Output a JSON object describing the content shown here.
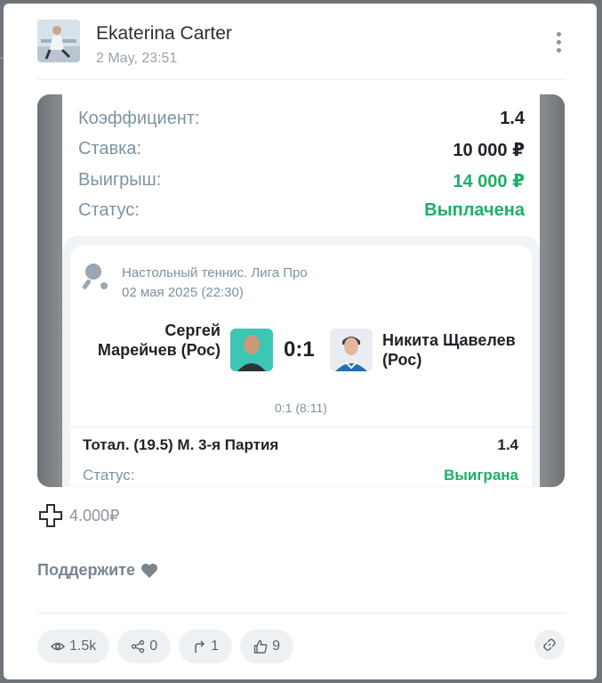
{
  "post": {
    "author": "Ekaterina Carter",
    "timestamp": "2 May, 23:51"
  },
  "bet": {
    "rows": [
      {
        "label": "Коэффициент:",
        "value": "1.4"
      },
      {
        "label": "Ставка:",
        "value": "10 000 ₽"
      },
      {
        "label": "Выигрыш:",
        "value": "14 000 ₽"
      },
      {
        "label": "Статус:",
        "value": "Выплачена"
      }
    ],
    "event": {
      "league": "Настольный теннис. Лига Про",
      "date": "02 мая 2025 (22:30)",
      "player1": "Сергей Марейчев (Рос)",
      "player2": "Никита Щавелев (Рос)",
      "score": "0:1",
      "set_score": "0:1 (8:11)",
      "market": "Тотал. (19.5) М. 3-я Партия",
      "market_odds": "1.4",
      "status_label": "Статус:",
      "status_value": "Выиграна"
    }
  },
  "tip": {
    "amount": "4.000₽"
  },
  "support": {
    "label": "Поддержите"
  },
  "actions": {
    "views": "1.5k",
    "shares": "0",
    "reposts": "1",
    "likes": "9"
  },
  "colors": {
    "accent_green": "#1bb069",
    "label_gray": "#7c94a4"
  }
}
